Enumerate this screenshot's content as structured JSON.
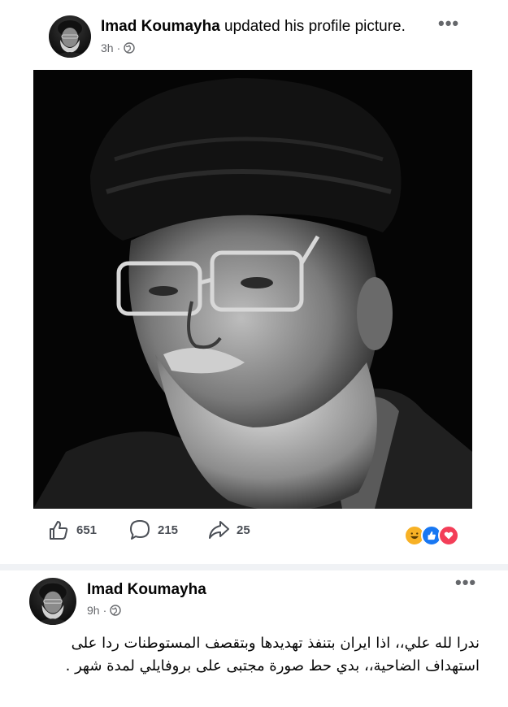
{
  "post1": {
    "author": "Imad Koumayha",
    "action_text": " updated his profile picture.",
    "time": "3h",
    "separator": "·",
    "privacy_icon": "globe-icon",
    "more_label": "•••"
  },
  "engagement": {
    "likes": "651",
    "comments": "215",
    "shares": "25",
    "reactions": [
      "haha",
      "like",
      "love"
    ]
  },
  "post2": {
    "author": "Imad Koumayha",
    "time": "9h",
    "separator": "·",
    "privacy_icon": "globe-icon",
    "more_label": "•••",
    "text": "ندرا لله علي،، اذا ايران بتنفذ تهديدها وبتقصف المستوطنات ردا على استهداف الضاحية،، بدي حط صورة مجتبى على بروفايلي لمدة شهر ."
  },
  "colors": {
    "meta_gray": "#65676b",
    "like_blue": "#1877f2",
    "love_red": "#f33e58",
    "haha_yellow": "#f7b125",
    "divider": "#f0f2f5"
  }
}
